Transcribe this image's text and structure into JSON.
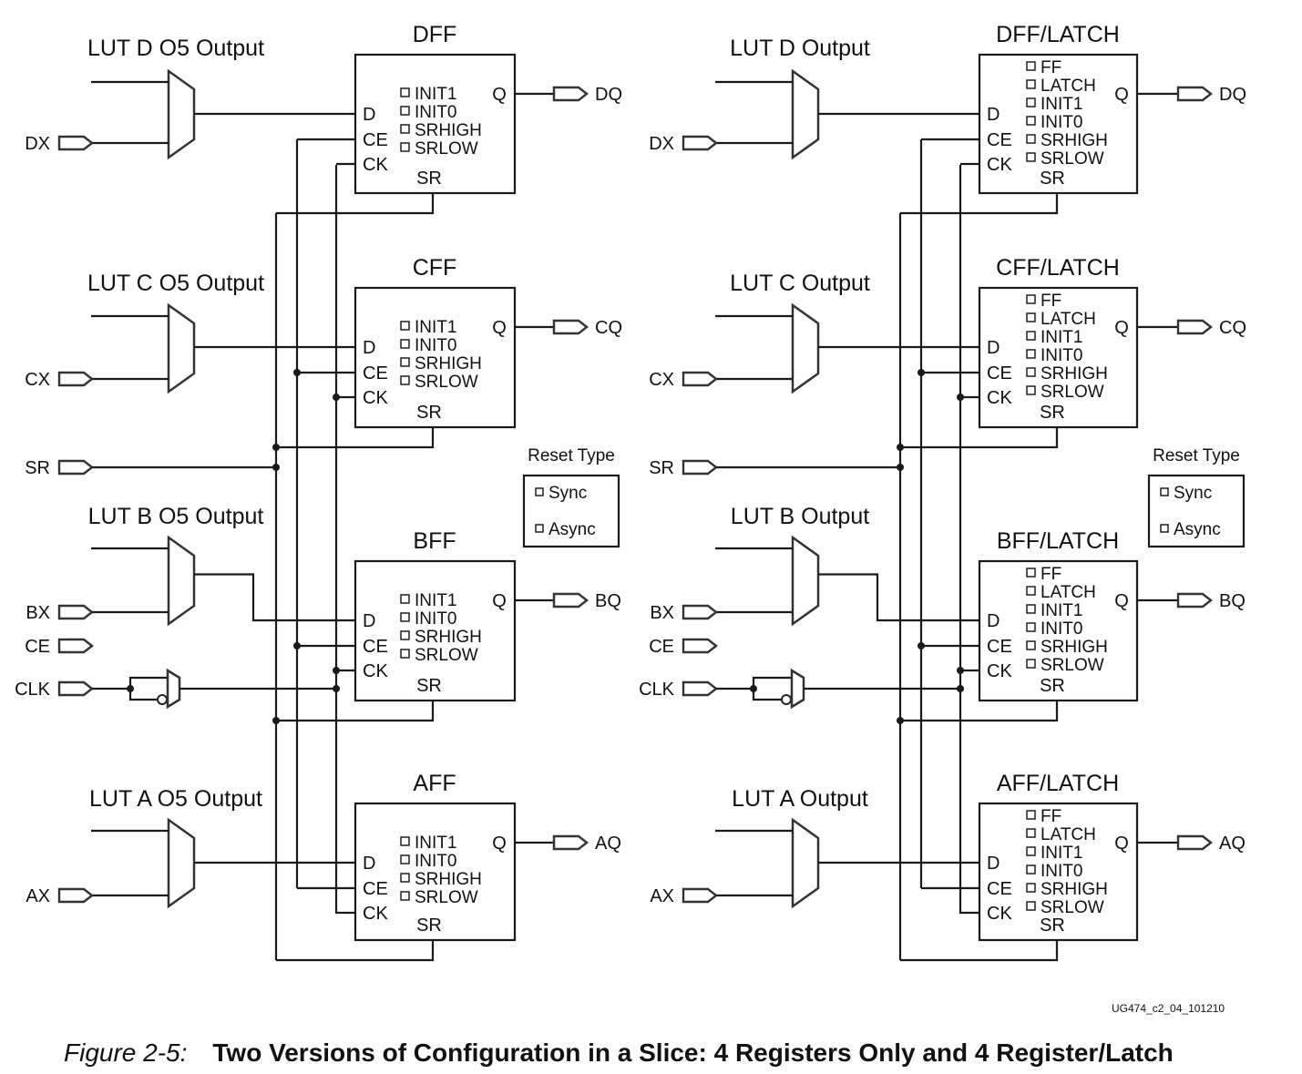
{
  "figure": {
    "number_label": "Figure 2-5:",
    "title": "Two Versions of Configuration in a Slice: 4 Registers Only and 4 Register/Latch",
    "doc_id": "UG474_c2_04_101210"
  },
  "inputs": {
    "dx": "DX",
    "cx": "CX",
    "bx": "BX",
    "ax": "AX",
    "sr": "SR",
    "ce": "CE",
    "clk": "CLK"
  },
  "pins": {
    "d": "D",
    "ce": "CE",
    "ck": "CK",
    "sr": "SR",
    "q": "Q"
  },
  "reset_type": {
    "title": "Reset Type",
    "options": [
      "Sync",
      "Async"
    ]
  },
  "left": {
    "name": "4 Registers Only",
    "luts": [
      "LUT D O5 Output",
      "LUT C O5 Output",
      "LUT B O5 Output",
      "LUT A O5 Output"
    ],
    "registers": [
      {
        "name": "DFF",
        "output": "DQ"
      },
      {
        "name": "CFF",
        "output": "CQ"
      },
      {
        "name": "BFF",
        "output": "BQ"
      },
      {
        "name": "AFF",
        "output": "AQ"
      }
    ],
    "options": [
      "INIT1",
      "INIT0",
      "SRHIGH",
      "SRLOW"
    ]
  },
  "right": {
    "name": "4 Register/Latch",
    "luts": [
      "LUT D Output",
      "LUT C Output",
      "LUT B Output",
      "LUT A Output"
    ],
    "registers": [
      {
        "name": "DFF/LATCH",
        "output": "DQ"
      },
      {
        "name": "CFF/LATCH",
        "output": "CQ"
      },
      {
        "name": "BFF/LATCH",
        "output": "BQ"
      },
      {
        "name": "AFF/LATCH",
        "output": "AQ"
      }
    ],
    "options": [
      "FF",
      "LATCH",
      "INIT1",
      "INIT0",
      "SRHIGH",
      "SRLOW"
    ]
  }
}
